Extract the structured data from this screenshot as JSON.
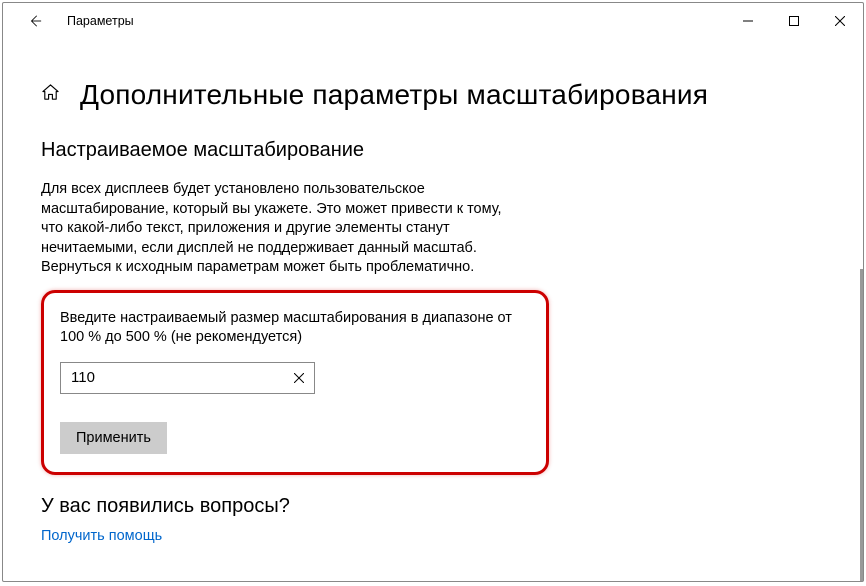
{
  "titlebar": {
    "title": "Параметры"
  },
  "page": {
    "title": "Дополнительные параметры масштабирования"
  },
  "section": {
    "title": "Настраиваемое масштабирование",
    "description": "Для всех дисплеев будет установлено пользовательское масштабирование, который вы укажете. Это может привести к тому, что какой-либо текст, приложения и другие элементы станут нечитаемыми, если дисплей не поддерживает данный масштаб. Вернуться к исходным параметрам может быть проблематично.",
    "input_label": "Введите настраиваемый размер масштабирования в диапазоне от 100 % до 500 % (не рекомендуется)",
    "input_value": "110",
    "apply_label": "Применить"
  },
  "footer": {
    "questions_title": "У вас появились вопросы?",
    "help_link": "Получить помощь"
  }
}
